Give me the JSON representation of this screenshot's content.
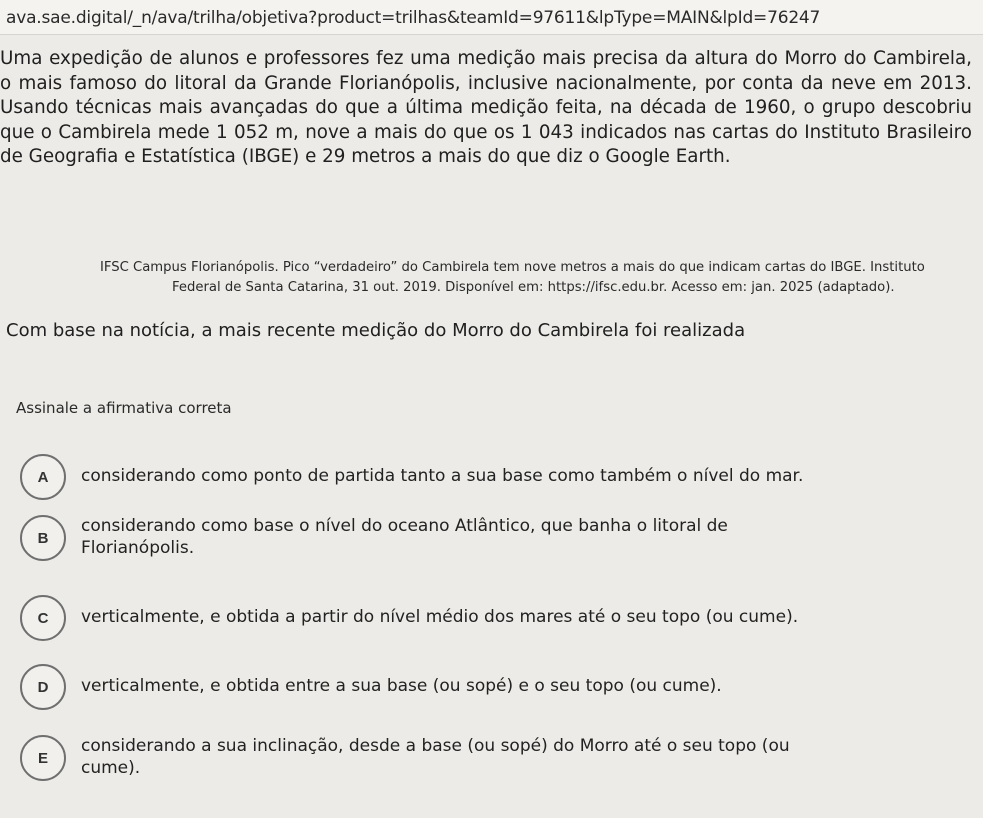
{
  "browser": {
    "url": "ava.sae.digital/_n/ava/trilha/objetiva?product=trilhas&teamId=97611&lpType=MAIN&lpId=76247"
  },
  "question": {
    "passage": "Uma expedição de alunos e professores fez uma medição mais precisa da altura do Morro do Cambirela, o mais famoso do litoral da Grande Florianópolis, inclusive nacionalmente, por conta da neve em 2013. Usando técnicas mais avançadas do que a última medição feita, na década de 1960, o grupo descobriu que o Cambirela mede 1 052 m, nove a mais do que os 1 043 indicados nas cartas do Instituto Brasileiro de Geografia e Estatística (IBGE) e 29 metros a mais do que diz o Google Earth.",
    "source_line1": "IFSC Campus Florianópolis. Pico “verdadeiro” do Cambirela tem nove metros a mais do que indicam cartas do IBGE. Instituto",
    "source_line2": "Federal de Santa Catarina, 31 out. 2019. Disponível em: https://ifsc.edu.br. Acesso em: jan. 2025 (adaptado).",
    "prompt": "Com base na notícia, a mais recente medição do Morro do Cambirela foi realizada",
    "instruction": "Assinale a afirmativa correta",
    "options": [
      {
        "letter": "A",
        "text": "considerando como ponto de partida tanto a sua base como também o nível do mar."
      },
      {
        "letter": "B",
        "text": "considerando como base o nível do oceano Atlântico, que banha o litoral de Florianópolis."
      },
      {
        "letter": "C",
        "text": "verticalmente, e obtida a partir do nível médio dos mares até o seu topo (ou cume)."
      },
      {
        "letter": "D",
        "text": "verticalmente, e obtida entre a sua base (ou sopé) e o seu topo (ou cume)."
      },
      {
        "letter": "E",
        "text": "considerando a sua inclinação, desde a base (ou sopé) do Morro até o seu topo (ou cume)."
      }
    ]
  }
}
